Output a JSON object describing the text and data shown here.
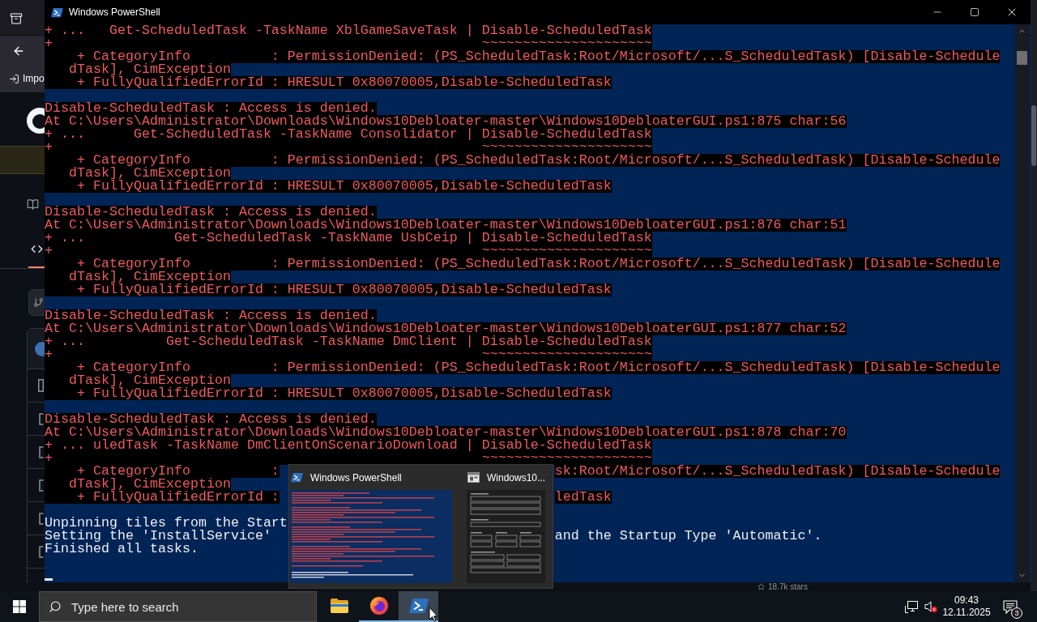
{
  "browser": {
    "bookmark": "Impo",
    "stars": "18.7k stars"
  },
  "window": {
    "title": "Windows PowerShell",
    "lines": [
      {
        "kind": "error",
        "text": "+ ...   Get-ScheduledTask -TaskName XblGameSaveTask | Disable-ScheduledTask"
      },
      {
        "kind": "error",
        "text": "+                                                     ~~~~~~~~~~~~~~~~~~~~~"
      },
      {
        "kind": "error",
        "text": "    + CategoryInfo          : PermissionDenied: (PS_ScheduledTask:Root/Microsoft/...S_ScheduledTask) [Disable-Schedule"
      },
      {
        "kind": "error",
        "text": "   dTask], CimException"
      },
      {
        "kind": "error",
        "text": "    + FullyQualifiedErrorId : HRESULT 0x80070005,Disable-ScheduledTask"
      },
      {
        "kind": "blank"
      },
      {
        "kind": "error",
        "text": "Disable-ScheduledTask : Access is denied."
      },
      {
        "kind": "error",
        "text": "At C:\\Users\\Administrator\\Downloads\\Windows10Debloater-master\\Windows10DebloaterGUI.ps1:875 char:56"
      },
      {
        "kind": "error",
        "text": "+ ...      Get-ScheduledTask -TaskName Consolidator | Disable-ScheduledTask"
      },
      {
        "kind": "error",
        "text": "+                                                     ~~~~~~~~~~~~~~~~~~~~~"
      },
      {
        "kind": "error",
        "text": "    + CategoryInfo          : PermissionDenied: (PS_ScheduledTask:Root/Microsoft/...S_ScheduledTask) [Disable-Schedule"
      },
      {
        "kind": "error",
        "text": "   dTask], CimException"
      },
      {
        "kind": "error",
        "text": "    + FullyQualifiedErrorId : HRESULT 0x80070005,Disable-ScheduledTask"
      },
      {
        "kind": "blank"
      },
      {
        "kind": "error",
        "text": "Disable-ScheduledTask : Access is denied."
      },
      {
        "kind": "error",
        "text": "At C:\\Users\\Administrator\\Downloads\\Windows10Debloater-master\\Windows10DebloaterGUI.ps1:876 char:51"
      },
      {
        "kind": "error",
        "text": "+ ...           Get-ScheduledTask -TaskName UsbCeip | Disable-ScheduledTask"
      },
      {
        "kind": "error",
        "text": "+                                                     ~~~~~~~~~~~~~~~~~~~~~"
      },
      {
        "kind": "error",
        "text": "    + CategoryInfo          : PermissionDenied: (PS_ScheduledTask:Root/Microsoft/...S_ScheduledTask) [Disable-Schedule"
      },
      {
        "kind": "error",
        "text": "   dTask], CimException"
      },
      {
        "kind": "error",
        "text": "    + FullyQualifiedErrorId : HRESULT 0x80070005,Disable-ScheduledTask"
      },
      {
        "kind": "blank"
      },
      {
        "kind": "error",
        "text": "Disable-ScheduledTask : Access is denied."
      },
      {
        "kind": "error",
        "text": "At C:\\Users\\Administrator\\Downloads\\Windows10Debloater-master\\Windows10DebloaterGUI.ps1:877 char:52"
      },
      {
        "kind": "error",
        "text": "+ ...          Get-ScheduledTask -TaskName DmClient | Disable-ScheduledTask"
      },
      {
        "kind": "error",
        "text": "+                                                     ~~~~~~~~~~~~~~~~~~~~~"
      },
      {
        "kind": "error",
        "text": "    + CategoryInfo          : PermissionDenied: (PS_ScheduledTask:Root/Microsoft/...S_ScheduledTask) [Disable-Schedule"
      },
      {
        "kind": "error",
        "text": "   dTask], CimException"
      },
      {
        "kind": "error",
        "text": "    + FullyQualifiedErrorId : HRESULT 0x80070005,Disable-ScheduledTask"
      },
      {
        "kind": "blank"
      },
      {
        "kind": "error",
        "text": "Disable-ScheduledTask : Access is denied."
      },
      {
        "kind": "error",
        "text": "At C:\\Users\\Administrator\\Downloads\\Windows10Debloater-master\\Windows10DebloaterGUI.ps1:878 char:70"
      },
      {
        "kind": "error",
        "text": "+ ... uledTask -TaskName DmClientOnScenarioDownload | Disable-ScheduledTask"
      },
      {
        "kind": "error",
        "text": "+                                                     ~~~~~~~~~~~~~~~~~~~~~"
      },
      {
        "kind": "error",
        "parts": [
          "    + CategoryInfo          :",
          "sk:Root/Microsoft/...S_ScheduledTask) [Disable-Schedule"
        ]
      },
      {
        "kind": "error",
        "text": "   dTask], CimException"
      },
      {
        "kind": "error",
        "parts": [
          "    + FullyQualifiedErrorId :",
          "ledTask"
        ]
      },
      {
        "kind": "blank"
      },
      {
        "kind": "output",
        "text": "Unpinning tiles from the Start"
      },
      {
        "kind": "output",
        "parts": [
          "Setting the 'InstallService'",
          "and the Startup Type 'Automatic'."
        ]
      },
      {
        "kind": "output",
        "text": "Finished all tasks."
      },
      {
        "kind": "blank"
      },
      {
        "kind": "cursor"
      }
    ]
  },
  "thumbnail_preview": {
    "items": [
      {
        "kind": "console",
        "title": "Windows PowerShell"
      },
      {
        "kind": "window",
        "title": "Windows10..."
      }
    ]
  },
  "taskbar": {
    "search": {
      "placeholder": "Type here to search"
    },
    "apps": [
      {
        "kind": "folder",
        "selected": false,
        "running": false
      },
      {
        "kind": "browser",
        "selected": false,
        "running": true
      },
      {
        "kind": "terminal",
        "selected": true,
        "running": true
      }
    ],
    "clock": {
      "time": "09:43",
      "date": "12.11.2025"
    },
    "notifications": {
      "count": "3"
    }
  }
}
